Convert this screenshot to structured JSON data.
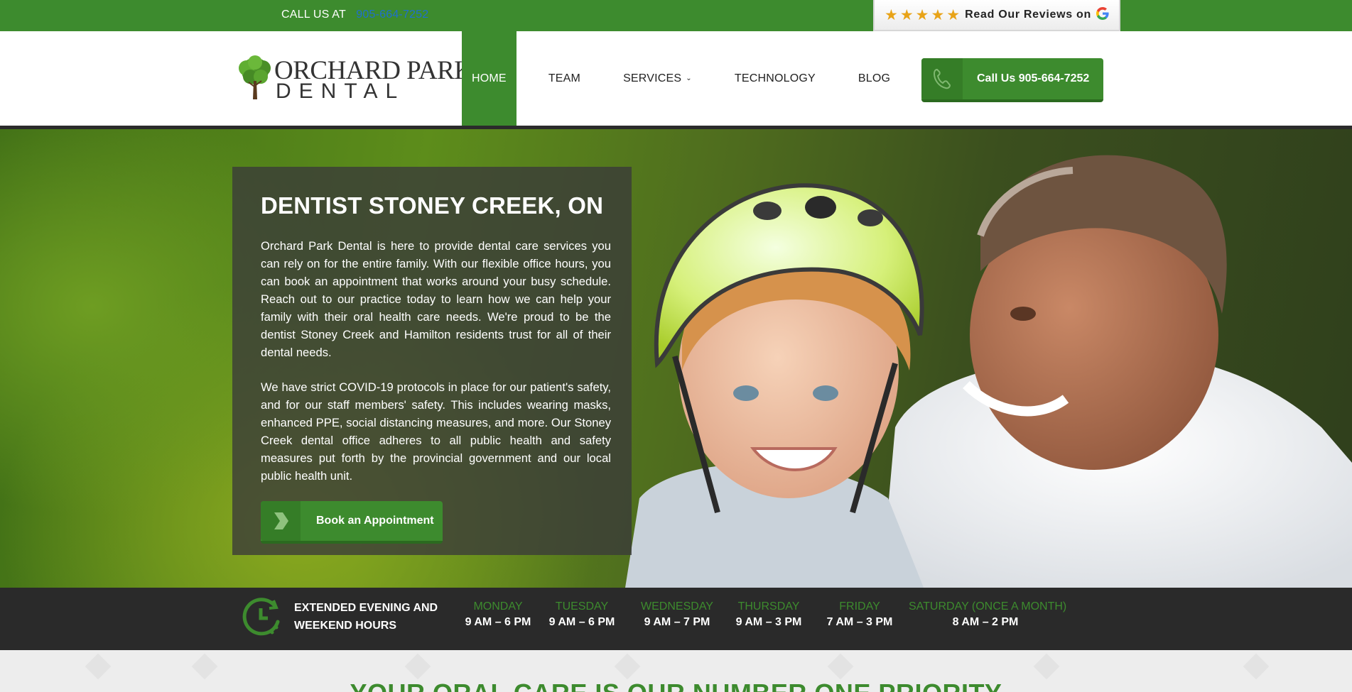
{
  "topbar": {
    "call_label": "CALL US AT",
    "call_number": "905-664-7252",
    "reviews_label": "Read Our Reviews on",
    "stars": "★★★★★",
    "reviews_icon": "google-g-icon"
  },
  "header": {
    "logo_line1": "ORCHARD PARK",
    "logo_line2": "DENTAL",
    "nav": [
      {
        "label": "HOME"
      },
      {
        "label": "TEAM"
      },
      {
        "label": "SERVICES"
      },
      {
        "label": "TECHNOLOGY"
      },
      {
        "label": "BLOG"
      }
    ],
    "call_button": "Call Us 905-664-7252"
  },
  "hero": {
    "title": "DENTIST STONEY CREEK, ON",
    "para1": "Orchard Park Dental is here to provide dental care services you can rely on for the entire family. With our flexible office hours, you can book an appointment that works around your busy schedule. Reach out to our practice today to learn how we can help your family with their oral health care needs. We're proud to be the dentist Stoney Creek and Hamilton residents trust for all of their dental needs.",
    "para2": "We have strict COVID-19 protocols in place for our patient's safety, and for our staff members' safety. This includes wearing masks, enhanced PPE, social distancing measures, and more. Our Stoney Creek dental office adheres to all public health and safety measures put forth by the provincial government and our local public health unit.",
    "book_button": "Book an Appointment"
  },
  "hours": {
    "line1": "EXTENDED EVENING AND",
    "line2": "WEEKEND HOURS",
    "days": [
      {
        "day": "MONDAY",
        "time": "9 AM – 6 PM"
      },
      {
        "day": "TUESDAY",
        "time": "9 AM – 6 PM"
      },
      {
        "day": "WEDNESDAY",
        "time": "9 AM – 7 PM"
      },
      {
        "day": "THURSDAY",
        "time": "9 AM – 3 PM"
      },
      {
        "day": "FRIDAY",
        "time": "7 AM – 3 PM"
      },
      {
        "day": "SATURDAY (ONCE A MONTH)",
        "time": "8 AM – 2 PM"
      }
    ]
  },
  "section": {
    "heading": "YOUR ORAL CARE IS OUR NUMBER ONE PRIORITY"
  },
  "colors": {
    "brand_green": "#3d8b2e",
    "dark_bar": "#2a2a2a",
    "link_blue": "#1f6fcf",
    "star_gold": "#e8a317"
  }
}
